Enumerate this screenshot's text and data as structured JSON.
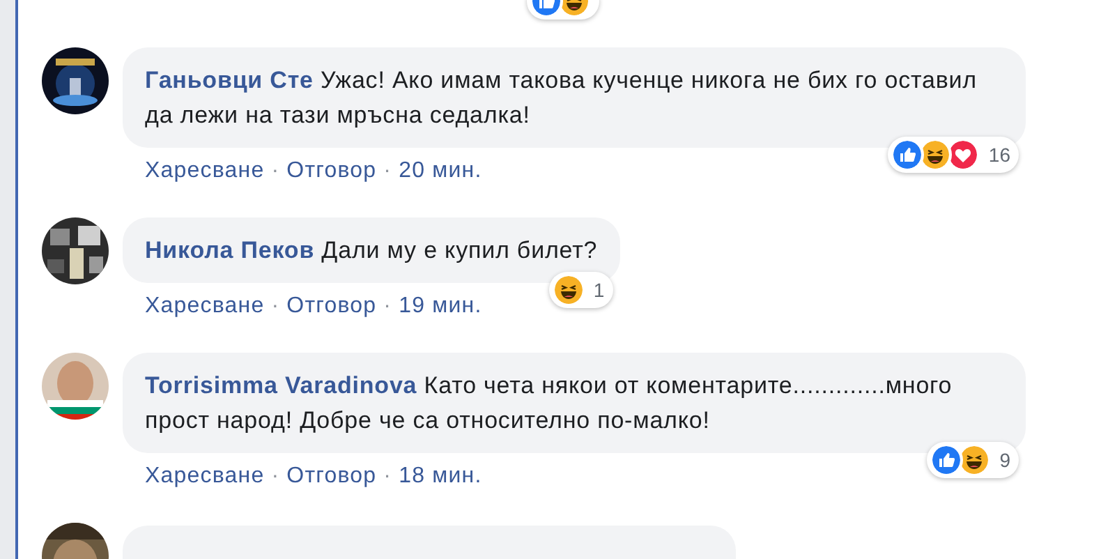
{
  "previous_reactions": [
    {
      "kind": "like"
    },
    {
      "kind": "haha"
    }
  ],
  "comments": [
    {
      "author": "Ганьовци Сте",
      "text": "Ужас! Ако имам такова кученце никога не бих го оставил да лежи на тази мръсна седалка!",
      "like": "Харесване",
      "separator_1": "·",
      "reply": "Отговор",
      "separator_2": "·",
      "time": "20 мин.",
      "reactions": [
        {
          "kind": "like"
        },
        {
          "kind": "haha"
        },
        {
          "kind": "love"
        }
      ],
      "reaction_count": "16"
    },
    {
      "author": "Никола Пеков",
      "text": "Дали му е купил билет?",
      "like": "Харесване",
      "separator_1": "·",
      "reply": "Отговор",
      "separator_2": "·",
      "time": "19 мин.",
      "reactions": [
        {
          "kind": "haha"
        }
      ],
      "reaction_count": "1"
    },
    {
      "author": "Torrisimma Varadinova",
      "text": "Като чета някои от коментарите.............много прост народ! Добре че са относително по-малко!",
      "like": "Харесване",
      "separator_1": "·",
      "reply": "Отговор",
      "separator_2": "·",
      "time": "18 мин.",
      "reactions": [
        {
          "kind": "like"
        },
        {
          "kind": "haha"
        }
      ],
      "reaction_count": "9"
    }
  ]
}
